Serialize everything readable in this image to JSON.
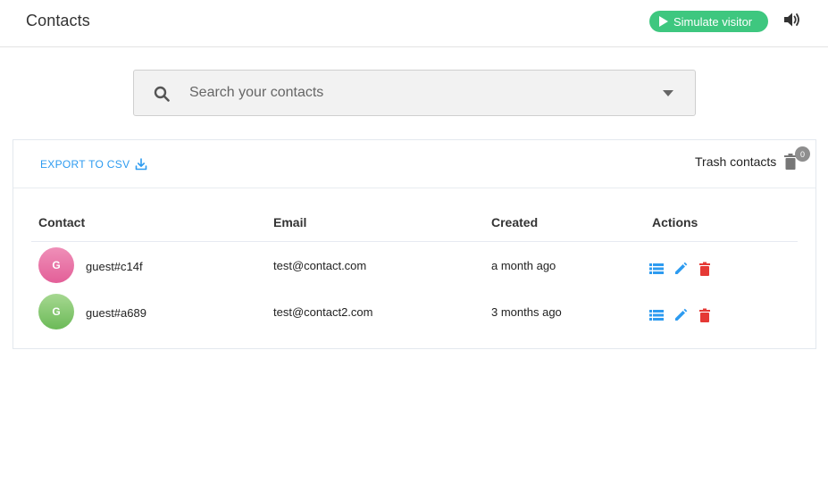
{
  "header": {
    "title": "Contacts",
    "simulate_label": "Simulate visitor",
    "accent": "#3ec77f"
  },
  "search": {
    "placeholder": "Search your contacts"
  },
  "toolbar": {
    "export_label": "EXPORT TO CSV",
    "trash_label": "Trash contacts",
    "trash_count": "0"
  },
  "table": {
    "columns": [
      "Contact",
      "Email",
      "Created",
      "Actions"
    ],
    "rows": [
      {
        "avatar_letter": "G",
        "avatar_color": "#e8679c",
        "name": "guest#c14f",
        "email": "test@contact.com",
        "created": "a month ago"
      },
      {
        "avatar_letter": "G",
        "avatar_color": "#7fc56a",
        "name": "guest#a689",
        "email": "test@contact2.com",
        "created": "3 months ago"
      }
    ],
    "action_icons": [
      "list-icon",
      "edit-icon",
      "delete-icon"
    ]
  },
  "colors": {
    "link": "#2d9bf0",
    "delete": "#e53935"
  }
}
